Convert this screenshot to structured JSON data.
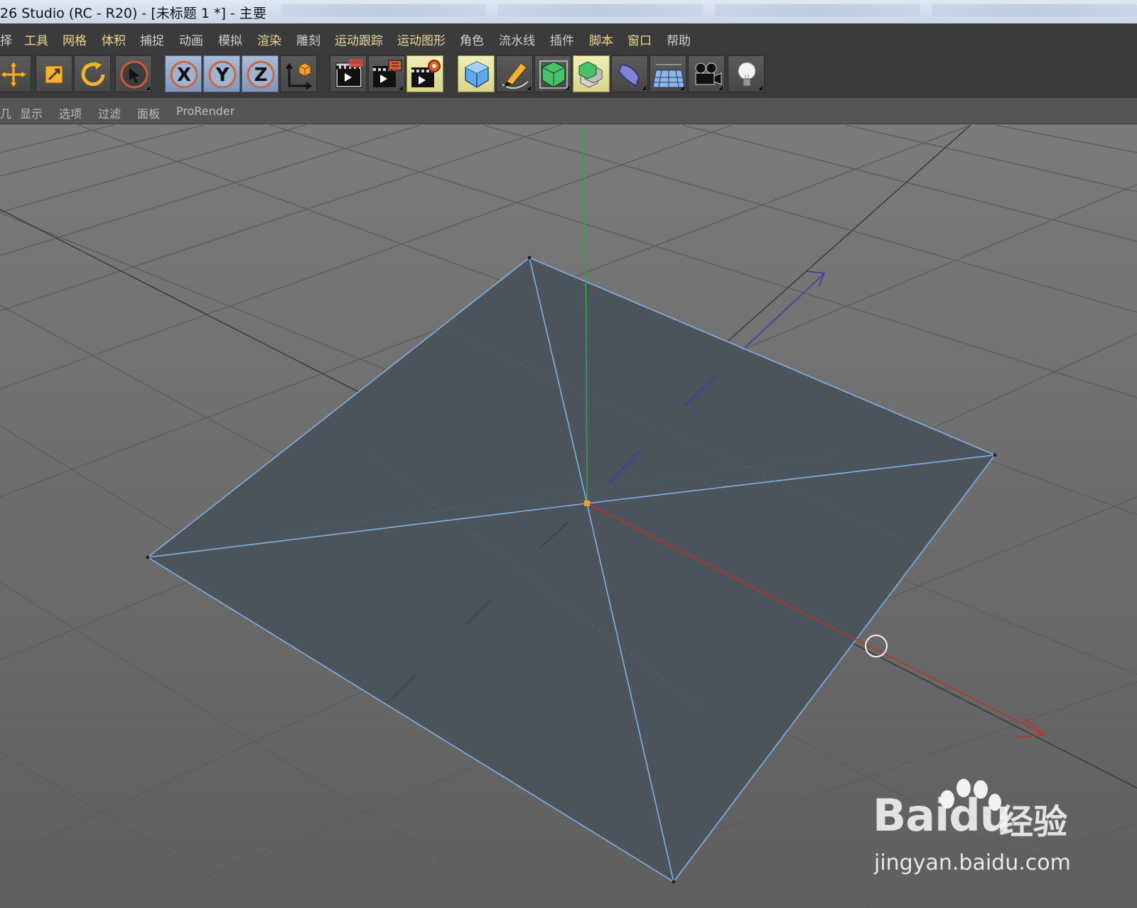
{
  "window": {
    "title": "26 Studio (RC - R20) - [未标题 1 *] - 主要"
  },
  "menubar": {
    "items": [
      {
        "label": "择",
        "highlight": false
      },
      {
        "label": "工具",
        "highlight": true
      },
      {
        "label": "网格",
        "highlight": true
      },
      {
        "label": "体积",
        "highlight": true
      },
      {
        "label": "捕捉",
        "highlight": false
      },
      {
        "label": "动画",
        "highlight": false
      },
      {
        "label": "模拟",
        "highlight": false
      },
      {
        "label": "渲染",
        "highlight": true
      },
      {
        "label": "雕刻",
        "highlight": false
      },
      {
        "label": "运动跟踪",
        "highlight": true
      },
      {
        "label": "运动图形",
        "highlight": true
      },
      {
        "label": "角色",
        "highlight": false
      },
      {
        "label": "流水线",
        "highlight": false
      },
      {
        "label": "插件",
        "highlight": false
      },
      {
        "label": "脚本",
        "highlight": true
      },
      {
        "label": "窗口",
        "highlight": true
      },
      {
        "label": "帮助",
        "highlight": false
      }
    ]
  },
  "toolbar": {
    "buttons": [
      {
        "icon": "move-icon"
      },
      {
        "icon": "scale-icon"
      },
      {
        "icon": "rotate-icon"
      },
      {
        "icon": "live-selection-icon"
      },
      {
        "icon": "x-axis-lock-icon",
        "label": "X"
      },
      {
        "icon": "y-axis-lock-icon",
        "label": "Y"
      },
      {
        "icon": "z-axis-lock-icon",
        "label": "Z"
      },
      {
        "icon": "coordinate-system-icon"
      },
      {
        "icon": "render-view-icon"
      },
      {
        "icon": "render-to-picture-viewer-icon"
      },
      {
        "icon": "render-settings-icon"
      },
      {
        "icon": "cube-icon"
      },
      {
        "icon": "pen-spline-icon"
      },
      {
        "icon": "subdivision-surface-icon"
      },
      {
        "icon": "cloner-icon"
      },
      {
        "icon": "deformer-icon"
      },
      {
        "icon": "floor-icon"
      },
      {
        "icon": "camera-icon"
      },
      {
        "icon": "light-icon"
      }
    ]
  },
  "viewport_menu": {
    "items": [
      "几",
      "显示",
      "选项",
      "过滤",
      "面板",
      "ProRender"
    ]
  },
  "colors": {
    "accent_yellow": "#e9d994",
    "poly_fill": "#4b535b",
    "edge": "#7fb2e6",
    "axis_x": "#c0302a",
    "axis_y": "#2fa84a",
    "axis_z": "#3640a8",
    "handle": "#f0a020"
  },
  "watermark": {
    "logo": "Bai",
    "logo_du": "du",
    "cn": "经验",
    "url": "jingyan.baidu.com"
  }
}
